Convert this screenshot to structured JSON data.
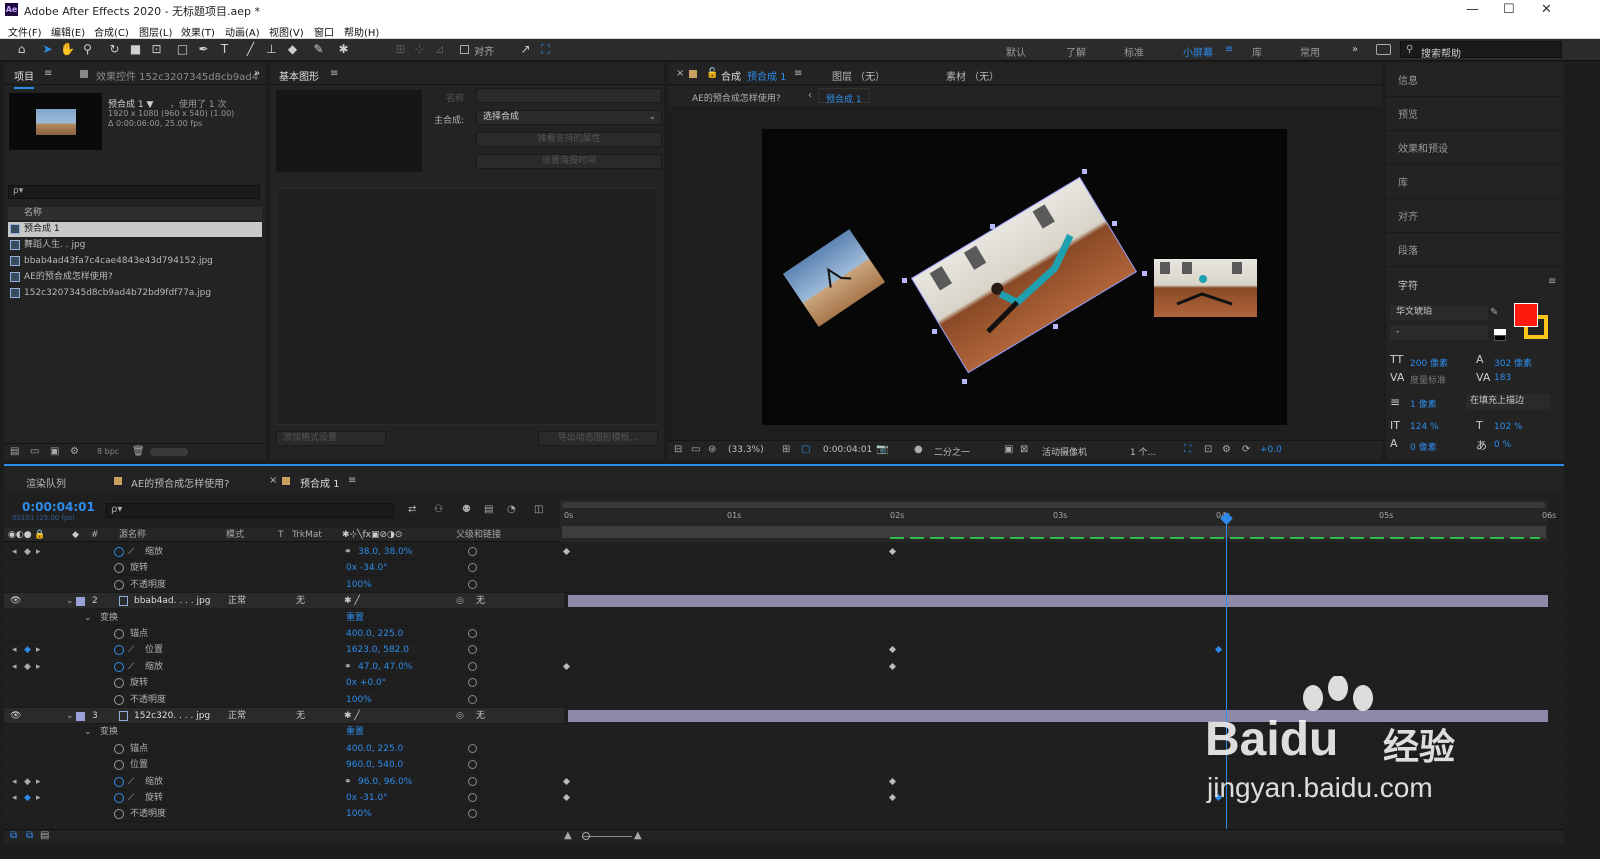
{
  "app": {
    "title": "Adobe After Effects 2020 - 无标题项目.aep *",
    "logo": "Ae"
  },
  "menu": [
    "文件(F)",
    "编辑(E)",
    "合成(C)",
    "图层(L)",
    "效果(T)",
    "动画(A)",
    "视图(V)",
    "窗口",
    "帮助(H)"
  ],
  "toolbar": {
    "align_label": "对齐",
    "workspaces": [
      "默认",
      "了解",
      "标准",
      "小屏幕",
      "库",
      "常用"
    ],
    "active_workspace": "小屏幕",
    "search_placeholder": "搜索帮助"
  },
  "project": {
    "tab": "项目",
    "effects_tab": "效果控件 152c3207345d8cb9ad4",
    "item_name": "预合成 1 ▼",
    "item_used": "，使用了 1 次",
    "item_size": "1920 x 1080  (960 x 540) (1.00)",
    "item_duration": "Δ 0:00:06:00, 25.00 fps",
    "search_placeholder": "ρ▾",
    "col_name": "名称",
    "bpc": "8 bpc",
    "items": [
      {
        "name": "预合成 1",
        "type": "comp",
        "selected": true
      },
      {
        "name": "舞蹈人生. . jpg",
        "type": "file"
      },
      {
        "name": "bbab4ad43fa7c4cae4843e43d794152.jpg",
        "type": "file"
      },
      {
        "name": "AE的预合成怎样使用?",
        "type": "comp"
      },
      {
        "name": "152c3207345d8cb9ad4b72bd9fdf77a.jpg",
        "type": "file"
      }
    ]
  },
  "essential": {
    "tab": "基本图形",
    "name_label": "名称",
    "master_label": "主合成:",
    "master_value": "选择合成",
    "btn1": "独看支持的属性",
    "btn2": "设置海报时间",
    "footer_left": "添加格式设置",
    "footer_right": "导出动态图形模板..."
  },
  "viewer": {
    "tab_comp": "合成",
    "tab_comp_name": "预合成 1",
    "tab_layer": "图层 （无）",
    "tab_footage": "素材 （无）",
    "crumb1": "AE的预合成怎样使用?",
    "crumb2": "预合成 1",
    "zoom": "(33.3%)",
    "time": "0:00:04:01",
    "resolution": "二分之一",
    "camera": "活动摄像机",
    "views": "1 个...",
    "exposure": "+0.0"
  },
  "right_panel": {
    "items": [
      "信息",
      "预览",
      "效果和预设",
      "库",
      "对齐",
      "段落"
    ],
    "char_title": "字符",
    "font": "华文琥珀",
    "font_style": "-",
    "size": "200 像素",
    "leading": "302 像素",
    "kerning": "度量标准",
    "tracking": "183",
    "stroke": "1 像素",
    "stroke_type": "在填充上描边",
    "vscale": "124 %",
    "hscale": "102 %",
    "baseline": "0 像素",
    "tsume": "0 %",
    "fill_color": "#ff1a10",
    "stroke_color": "#f5c518"
  },
  "timeline": {
    "tab_render": "渲染队列",
    "tab_comp1": "AE的预合成怎样使用?",
    "tab_comp2": "预合成 1",
    "timecode": "0:00:04:01",
    "frames": "00101 (25.00 fps)",
    "col_source": "源名称",
    "col_mode": "模式",
    "col_t": "T",
    "col_trkmat": "TrkMat",
    "col_parent": "父级和链接",
    "ruler": [
      "0s",
      "01s",
      "02s",
      "03s",
      "04s",
      "05s",
      "06s"
    ],
    "rows": [
      {
        "kind": "prop",
        "name": "缩放",
        "value": "38.0, 38.0%",
        "link": true,
        "kfs": [
          0,
          2
        ]
      },
      {
        "kind": "prop",
        "name": "旋转",
        "value": "0x -34.0°"
      },
      {
        "kind": "prop",
        "name": "不透明度",
        "value": "100%"
      },
      {
        "kind": "layer",
        "num": "2",
        "name": "bbab4ad. . . . jpg",
        "mode": "正常",
        "trk": "无",
        "parent": "无"
      },
      {
        "kind": "group",
        "name": "变换",
        "value": "重置"
      },
      {
        "kind": "prop",
        "name": "锚点",
        "value": "400.0, 225.0"
      },
      {
        "kind": "prop",
        "name": "位置",
        "value": "1623.0, 582.0",
        "kfs": [
          2,
          4
        ]
      },
      {
        "kind": "prop",
        "name": "缩放",
        "value": "47.0, 47.0%",
        "link": true,
        "kfs": [
          0,
          2
        ]
      },
      {
        "kind": "prop",
        "name": "旋转",
        "value": "0x +0.0°"
      },
      {
        "kind": "prop",
        "name": "不透明度",
        "value": "100%"
      },
      {
        "kind": "layer",
        "num": "3",
        "name": "152c320. . . . jpg",
        "mode": "正常",
        "trk": "无",
        "parent": "无"
      },
      {
        "kind": "group",
        "name": "变换",
        "value": "重置"
      },
      {
        "kind": "prop",
        "name": "锚点",
        "value": "400.0, 225.0"
      },
      {
        "kind": "prop",
        "name": "位置",
        "value": "960.0, 540.0"
      },
      {
        "kind": "prop",
        "name": "缩放",
        "value": "96.0, 96.0%",
        "link": true,
        "kfs": [
          0,
          2
        ]
      },
      {
        "kind": "prop",
        "name": "旋转",
        "value": "0x -31.0°",
        "kfs": [
          0,
          2,
          4
        ]
      },
      {
        "kind": "prop",
        "name": "不透明度",
        "value": "100%"
      }
    ]
  },
  "watermark": {
    "brand": "Baidu",
    "brand2": "经验",
    "url": "jingyan.baidu.com"
  }
}
